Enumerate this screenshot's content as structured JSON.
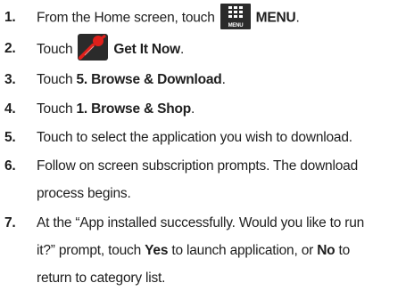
{
  "colors": {
    "text": "#1e1e1e",
    "menu_icon_bg": "#2b2b2b",
    "getit_red": "#e0201b"
  },
  "icons": {
    "menu": "menu-icon",
    "get_it_now": "get-it-now-icon"
  },
  "menu_icon_caption": "MENU",
  "steps": [
    {
      "num": "1.",
      "pre": "From the Home screen, touch",
      "bold": "MENU",
      "post": "."
    },
    {
      "num": "2.",
      "pre": "Touch",
      "bold": "Get It Now",
      "post": "."
    },
    {
      "num": "3.",
      "pre": "Touch ",
      "bold": "5. Browse & Download",
      "post": "."
    },
    {
      "num": "4.",
      "pre": "Touch ",
      "bold": "1. Browse & Shop",
      "post": "."
    },
    {
      "num": "5.",
      "text": "Touch to select the application you wish to download."
    },
    {
      "num": "6.",
      "line1": "Follow on screen subscription prompts. The download",
      "line2": "process begins."
    },
    {
      "num": "7.",
      "line1": "At the “App installed successfully. Would you like to run",
      "line2_pre": "it?” prompt, touch ",
      "line2_b1": "Yes",
      "line2_mid": " to launch application, or ",
      "line2_b2": "No",
      "line2_post": " to",
      "line3": "return to category list."
    }
  ]
}
